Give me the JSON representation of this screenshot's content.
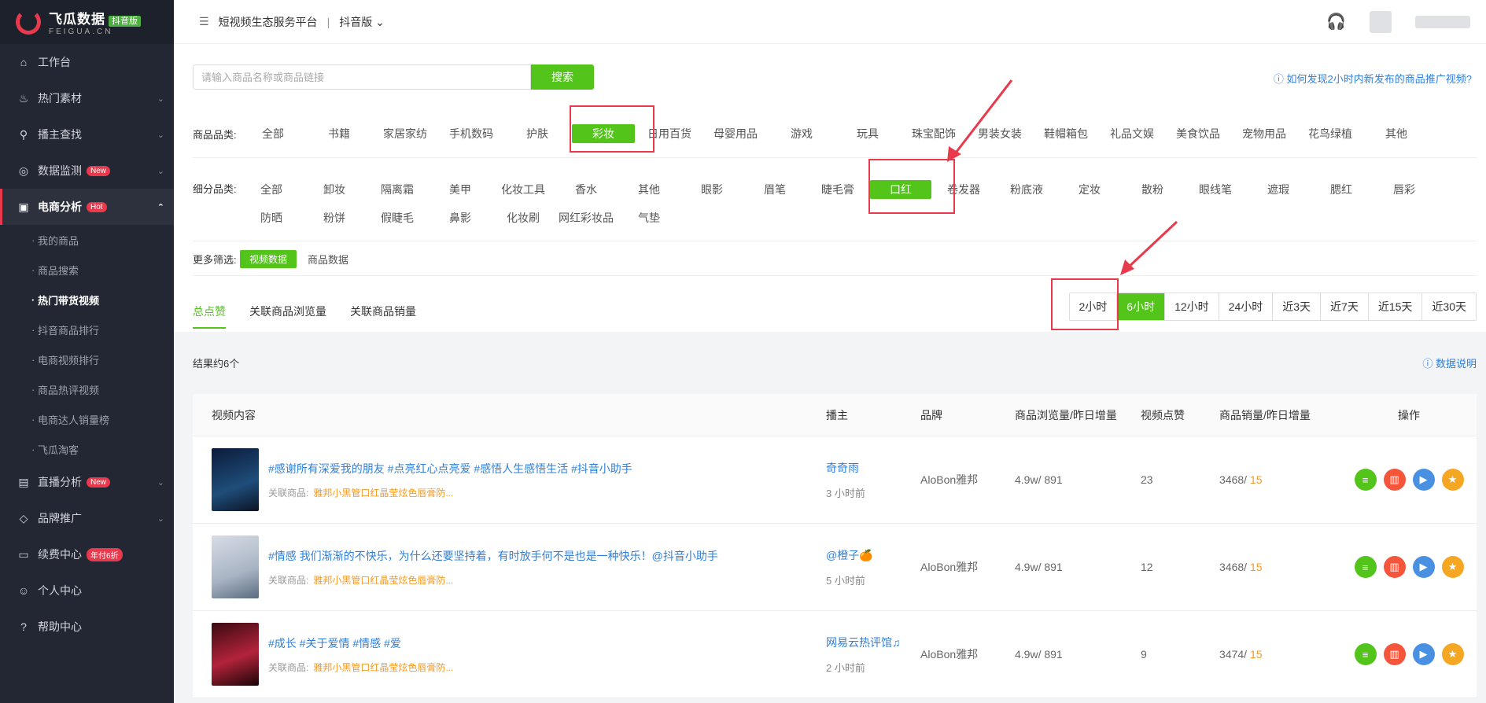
{
  "sidebar": {
    "logo": {
      "name": "飞瓜数据",
      "sub": "FEIGUA.CN",
      "badge": "抖音版"
    },
    "items": [
      {
        "label": "工作台",
        "icon": "home-icon"
      },
      {
        "label": "热门素材",
        "icon": "fire-icon"
      },
      {
        "label": "播主查找",
        "icon": "search-icon"
      },
      {
        "label": "数据监测",
        "icon": "monitor-icon",
        "tag": "New"
      },
      {
        "label": "电商分析",
        "icon": "shop-bag-icon",
        "tag": "Hot"
      },
      {
        "label": "直播分析",
        "icon": "live-icon",
        "tag": "New"
      },
      {
        "label": "品牌推广",
        "icon": "diamond-icon"
      },
      {
        "label": "续费中心",
        "icon": "card-icon",
        "tag": "年付6折"
      },
      {
        "label": "个人中心",
        "icon": "user-icon"
      },
      {
        "label": "帮助中心",
        "icon": "help-icon"
      }
    ],
    "sub_items": [
      "我的商品",
      "商品搜索",
      "热门带货视频",
      "抖音商品排行",
      "电商视频排行",
      "商品热评视频",
      "电商达人销量榜",
      "飞瓜淘客"
    ]
  },
  "topbar": {
    "title": "短视频生态服务平台",
    "sep": "|",
    "version": "抖音版"
  },
  "search": {
    "placeholder": "请输入商品名称或商品链接",
    "button": "搜索"
  },
  "help_link": "如何发现2小时内新发布的商品推广视频?",
  "category": {
    "label": "商品品类:",
    "items": [
      "全部",
      "书籍",
      "家居家纺",
      "手机数码",
      "护肤",
      "彩妆",
      "日用百货",
      "母婴用品",
      "游戏",
      "玩具",
      "珠宝配饰",
      "男装女装",
      "鞋帽箱包",
      "礼品文娱",
      "美食饮品",
      "宠物用品",
      "花鸟绿植",
      "其他"
    ],
    "selected": "彩妆"
  },
  "subcategory": {
    "label": "细分品类:",
    "items": [
      "全部",
      "卸妆",
      "隔离霜",
      "美甲",
      "化妆工具",
      "香水",
      "其他",
      "眼影",
      "眉笔",
      "睫毛膏",
      "口红",
      "卷发器",
      "粉底液",
      "定妆",
      "散粉",
      "眼线笔",
      "遮瑕",
      "腮红",
      "唇彩",
      "防晒",
      "粉饼",
      "假睫毛",
      "鼻影",
      "化妆刷",
      "网红彩妆品",
      "气垫"
    ],
    "selected": "口红"
  },
  "more": {
    "label": "更多筛选:",
    "options": [
      "视频数据",
      "商品数据"
    ]
  },
  "tabs": [
    "总点赞",
    "关联商品浏览量",
    "关联商品销量"
  ],
  "time_ranges": [
    "2小时",
    "6小时",
    "12小时",
    "24小时",
    "近3天",
    "近7天",
    "近15天",
    "近30天"
  ],
  "time_selected": "6小时",
  "result_text": "结果约6个",
  "data_explain": "数据说明",
  "table": {
    "headers": [
      "视频内容",
      "播主",
      "品牌",
      "商品浏览量/昨日增量",
      "视频点赞",
      "商品销量/昨日增量",
      "操作"
    ],
    "rows": [
      {
        "title": "#感谢所有深爱我的朋友 #点亮红心点亮爱 #感悟人生感悟生活 #抖音小助手",
        "rel_label": "关联商品:",
        "rel_product": "雅邦小黑管口红晶莹炫色唇膏防...",
        "anchor": "奇奇雨",
        "time": "3 小时前",
        "brand": "AloBon雅邦",
        "views": "4.9w/ 891",
        "likes": "23",
        "sales": "3468/",
        "sales_inc": "15"
      },
      {
        "title": "#情感 我们渐渐的不快乐，为什么还要坚持着，有时放手何不是也是一种快乐！@抖音小助手",
        "rel_label": "关联商品:",
        "rel_product": "雅邦小黑管口红晶莹炫色唇膏防...",
        "anchor": "@橙子🍊",
        "time": "5 小时前",
        "brand": "AloBon雅邦",
        "views": "4.9w/ 891",
        "likes": "12",
        "sales": "3468/",
        "sales_inc": "15"
      },
      {
        "title": "#成长 #关于爱情 #情感 #爱",
        "rel_label": "关联商品:",
        "rel_product": "雅邦小黑管口红晶莹炫色唇膏防...",
        "anchor": "网易云热评馆♫",
        "time": "2 小时前",
        "brand": "AloBon雅邦",
        "views": "4.9w/ 891",
        "likes": "9",
        "sales": "3474/",
        "sales_inc": "15"
      }
    ]
  }
}
